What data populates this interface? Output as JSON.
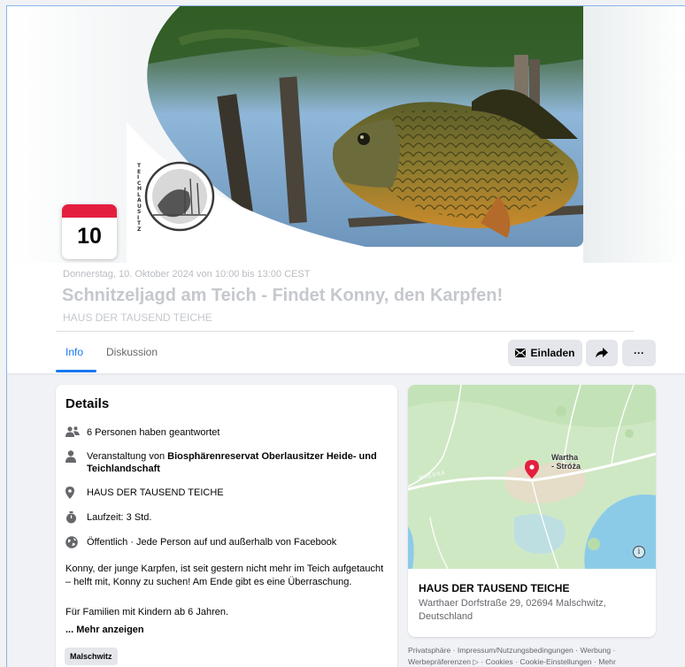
{
  "event": {
    "date_day": "10",
    "when": "Donnerstag, 10. Oktober 2024 von 10:00 bis 13:00 CEST",
    "title": "Schnitzeljagd am Teich - Findet Konny, den Karpfen!",
    "host": "HAUS DER TAUSEND TEICHE"
  },
  "cover": {
    "logo_vertical_text": "TEICHLAUSITZ"
  },
  "tabs": [
    {
      "label": "Info",
      "active": true
    },
    {
      "label": "Diskussion",
      "active": false
    }
  ],
  "actions": {
    "invite_label": "Einladen",
    "share_icon": "share-arrow-icon",
    "more_label": "···"
  },
  "details": {
    "heading": "Details",
    "responses": "6 Personen haben geantwortet",
    "organizer_prefix": "Veranstaltung von ",
    "organizer_name": "Biosphärenreservat Oberlausitzer Heide- und Teichlandschaft",
    "location": "HAUS DER TAUSEND TEICHE",
    "duration": "Laufzeit: 3 Std.",
    "privacy": "Öffentlich · Jede Person auf und außerhalb von Facebook",
    "description": "Konny, der junge Karpfen, ist seit gestern nicht mehr im Teich aufgetaucht – helft mit, Konny zu suchen! Am Ende gibt es eine Überraschung.",
    "description_2": "Für Familien mit Kindern ab 6 Jahren.",
    "more_link": "... Mehr anzeigen",
    "tag": "Malschwitz"
  },
  "map": {
    "place_label": "Wartha\n- Stróża",
    "road_label": "WJESNA",
    "info_icon": "info-icon",
    "place_name": "HAUS DER TAUSEND TEICHE",
    "address": "Warthaer Dorfstraße 29, 02694 Malschwitz, Deutschland"
  },
  "footer": {
    "links": [
      "Privatsphäre",
      "Impressum/Nutzungsbedingungen",
      "Werbung",
      "Werbepräferenzen",
      "Cookies",
      "Cookie-Einstellungen",
      "Mehr"
    ]
  },
  "colors": {
    "accent": "#1877f2",
    "date_red": "#e41e3f",
    "button_bg": "#e4e6eb",
    "page_bg": "#f0f2f5"
  }
}
